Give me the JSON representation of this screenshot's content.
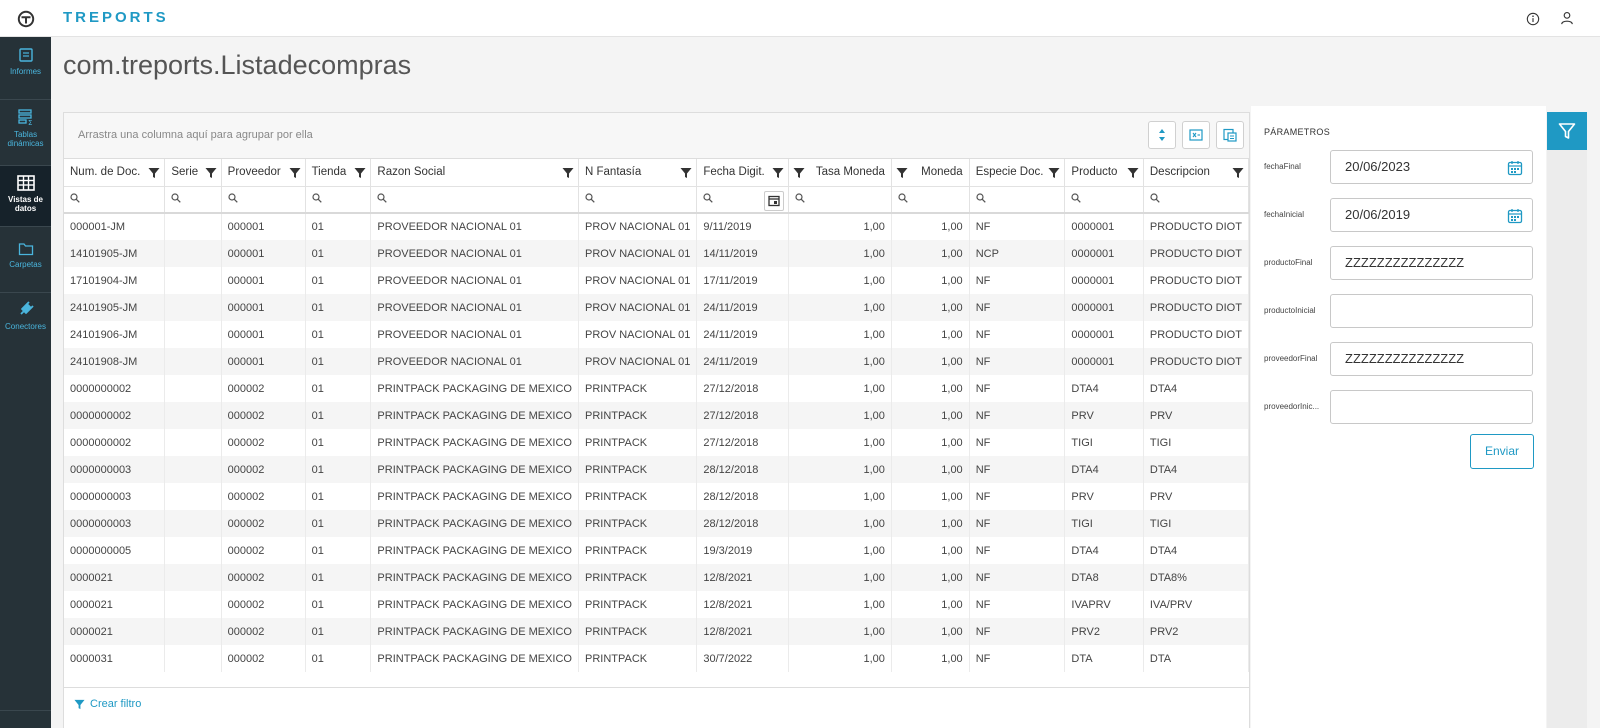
{
  "app": {
    "brand": "TREPORTS"
  },
  "page": {
    "title": "com.treports.Listadecompras"
  },
  "sidebar": {
    "items": [
      {
        "label": "Informes",
        "icon": "report-icon"
      },
      {
        "label": "Tablas dinámicas",
        "icon": "pivot-table-icon"
      },
      {
        "label": "Vistas de datos",
        "icon": "table-grid-icon",
        "active": true
      },
      {
        "label": "Carpetas",
        "icon": "folder-icon"
      },
      {
        "label": "Conectores",
        "icon": "plug-icon"
      }
    ]
  },
  "grid": {
    "group_hint": "Arrastra una columna aquí para agrupar por ella",
    "columns": [
      "Num. de Doc.",
      "Serie",
      "Proveedor",
      "Tienda",
      "Razon Social",
      "N Fantasía",
      "Fecha Digit.",
      "Tasa Moneda",
      "Moneda",
      "Especie Doc.",
      "Producto",
      "Descripcion"
    ],
    "rows": [
      [
        "000001-JM",
        "",
        "000001",
        "01",
        "PROVEEDOR NACIONAL 01",
        "PROV NACIONAL 01",
        "9/11/2019",
        "1,00",
        "1,00",
        "NF",
        "0000001",
        "PRODUCTO DIOT"
      ],
      [
        "14101905-JM",
        "",
        "000001",
        "01",
        "PROVEEDOR NACIONAL 01",
        "PROV NACIONAL 01",
        "14/11/2019",
        "1,00",
        "1,00",
        "NCP",
        "0000001",
        "PRODUCTO DIOT"
      ],
      [
        "17101904-JM",
        "",
        "000001",
        "01",
        "PROVEEDOR NACIONAL 01",
        "PROV NACIONAL 01",
        "17/11/2019",
        "1,00",
        "1,00",
        "NF",
        "0000001",
        "PRODUCTO DIOT"
      ],
      [
        "24101905-JM",
        "",
        "000001",
        "01",
        "PROVEEDOR NACIONAL 01",
        "PROV NACIONAL 01",
        "24/11/2019",
        "1,00",
        "1,00",
        "NF",
        "0000001",
        "PRODUCTO DIOT"
      ],
      [
        "24101906-JM",
        "",
        "000001",
        "01",
        "PROVEEDOR NACIONAL 01",
        "PROV NACIONAL 01",
        "24/11/2019",
        "1,00",
        "1,00",
        "NF",
        "0000001",
        "PRODUCTO DIOT"
      ],
      [
        "24101908-JM",
        "",
        "000001",
        "01",
        "PROVEEDOR NACIONAL 01",
        "PROV NACIONAL 01",
        "24/11/2019",
        "1,00",
        "1,00",
        "NF",
        "0000001",
        "PRODUCTO DIOT"
      ],
      [
        "0000000002",
        "",
        "000002",
        "01",
        "PRINTPACK PACKAGING DE MEXICO",
        "PRINTPACK",
        "27/12/2018",
        "1,00",
        "1,00",
        "NF",
        "DTA4",
        "DTA4"
      ],
      [
        "0000000002",
        "",
        "000002",
        "01",
        "PRINTPACK PACKAGING DE MEXICO",
        "PRINTPACK",
        "27/12/2018",
        "1,00",
        "1,00",
        "NF",
        "PRV",
        "PRV"
      ],
      [
        "0000000002",
        "",
        "000002",
        "01",
        "PRINTPACK PACKAGING DE MEXICO",
        "PRINTPACK",
        "27/12/2018",
        "1,00",
        "1,00",
        "NF",
        "TIGI",
        "TIGI"
      ],
      [
        "0000000003",
        "",
        "000002",
        "01",
        "PRINTPACK PACKAGING DE MEXICO",
        "PRINTPACK",
        "28/12/2018",
        "1,00",
        "1,00",
        "NF",
        "DTA4",
        "DTA4"
      ],
      [
        "0000000003",
        "",
        "000002",
        "01",
        "PRINTPACK PACKAGING DE MEXICO",
        "PRINTPACK",
        "28/12/2018",
        "1,00",
        "1,00",
        "NF",
        "PRV",
        "PRV"
      ],
      [
        "0000000003",
        "",
        "000002",
        "01",
        "PRINTPACK PACKAGING DE MEXICO",
        "PRINTPACK",
        "28/12/2018",
        "1,00",
        "1,00",
        "NF",
        "TIGI",
        "TIGI"
      ],
      [
        "0000000005",
        "",
        "000002",
        "01",
        "PRINTPACK PACKAGING DE MEXICO",
        "PRINTPACK",
        "19/3/2019",
        "1,00",
        "1,00",
        "NF",
        "DTA4",
        "DTA4"
      ],
      [
        "0000021",
        "",
        "000002",
        "01",
        "PRINTPACK PACKAGING DE MEXICO",
        "PRINTPACK",
        "12/8/2021",
        "1,00",
        "1,00",
        "NF",
        "DTA8",
        "DTA8%"
      ],
      [
        "0000021",
        "",
        "000002",
        "01",
        "PRINTPACK PACKAGING DE MEXICO",
        "PRINTPACK",
        "12/8/2021",
        "1,00",
        "1,00",
        "NF",
        "IVAPRV",
        "IVA/PRV"
      ],
      [
        "0000021",
        "",
        "000002",
        "01",
        "PRINTPACK PACKAGING DE MEXICO",
        "PRINTPACK",
        "12/8/2021",
        "1,00",
        "1,00",
        "NF",
        "PRV2",
        "PRV2"
      ],
      [
        "0000031",
        "",
        "000002",
        "01",
        "PRINTPACK PACKAGING DE MEXICO",
        "PRINTPACK",
        "30/7/2022",
        "1,00",
        "1,00",
        "NF",
        "DTA",
        "DTA"
      ]
    ],
    "create_filter": "Crear filtro"
  },
  "params": {
    "title": "PÁRAMETROS",
    "fields": [
      {
        "label": "fechaFinal",
        "value": "20/06/2023",
        "type": "date"
      },
      {
        "label": "fechaInicial",
        "value": "20/06/2019",
        "type": "date"
      },
      {
        "label": "productoFinal",
        "value": "ZZZZZZZZZZZZZZZ",
        "type": "text"
      },
      {
        "label": "productoInicial",
        "value": "",
        "type": "text"
      },
      {
        "label": "proveedorFinal",
        "value": "ZZZZZZZZZZZZZZZ",
        "type": "text"
      },
      {
        "label": "proveedorInic...",
        "value": "",
        "type": "text"
      }
    ],
    "submit_label": "Enviar"
  },
  "colors": {
    "accent": "#1f99c4",
    "sidebar": "#263238"
  }
}
